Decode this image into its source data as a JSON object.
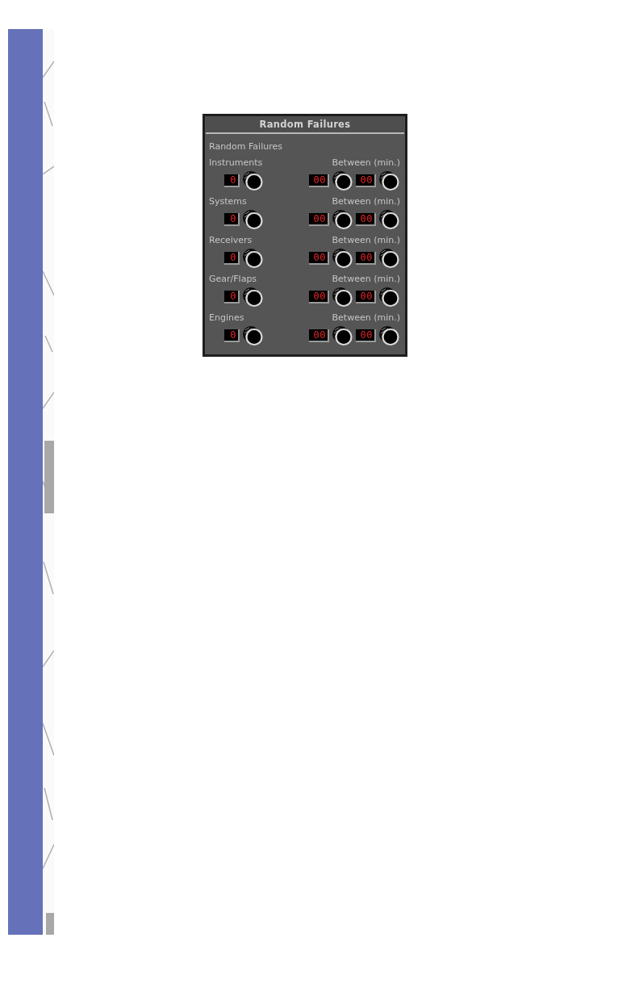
{
  "panel": {
    "title": "Random Failures",
    "heading": "Random Failures",
    "rows": [
      {
        "label": "Instruments",
        "between_label": "Between (min.)",
        "count": "0",
        "between_from": "00",
        "between_to": "00"
      },
      {
        "label": "Systems",
        "between_label": "Between (min.)",
        "count": "0",
        "between_from": "00",
        "between_to": "00"
      },
      {
        "label": "Receivers",
        "between_label": "Between (min.)",
        "count": "0",
        "between_from": "00",
        "between_to": "00"
      },
      {
        "label": "Gear/Flaps",
        "between_label": "Between (min.)",
        "count": "0",
        "between_from": "00",
        "between_to": "00"
      },
      {
        "label": "Engines",
        "between_label": "Between (min.)",
        "count": "0",
        "between_from": "00",
        "between_to": "00"
      }
    ]
  }
}
